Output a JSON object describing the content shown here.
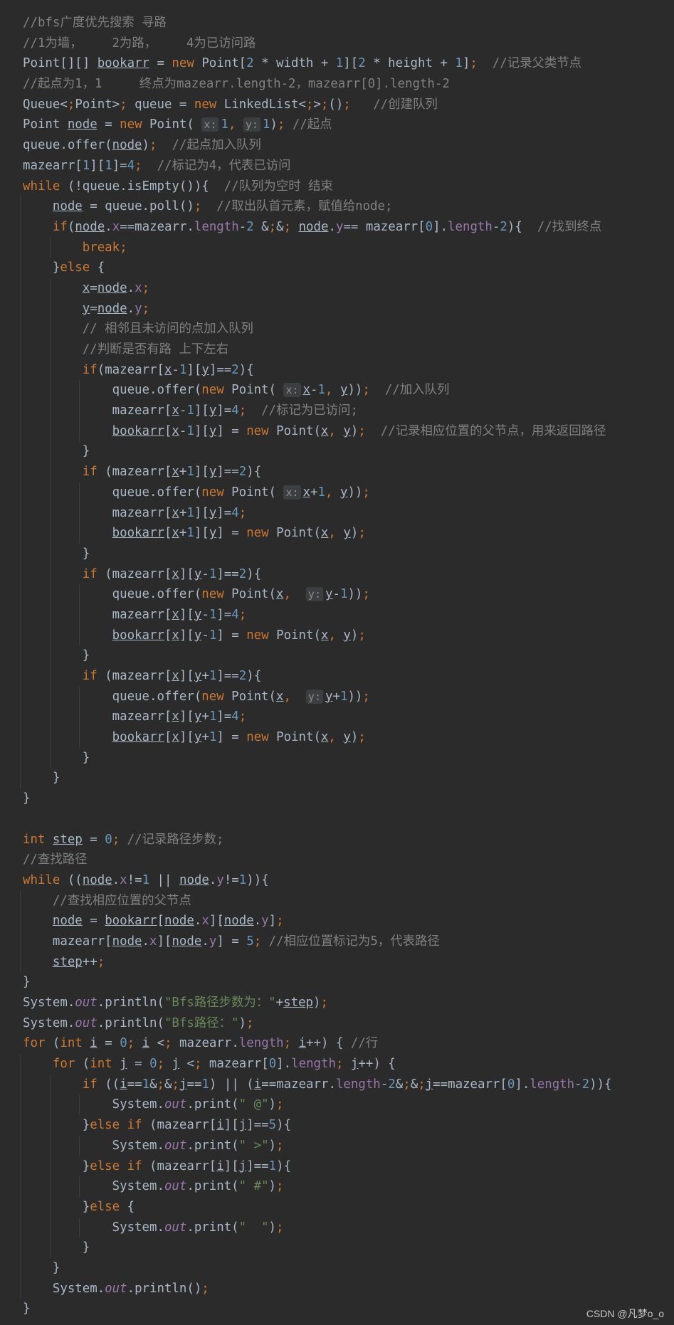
{
  "watermark": "CSDN @凡梦o_o",
  "code_lines": [
    "//bfs广度优先搜索 寻路",
    "//1为墙，    2为路，    4为已访问路",
    "Point[][] bookarr = new Point[2 * width + 1][2 * height + 1];  //记录父类节点",
    "//起点为1，1     终点为mazearr.length-2，mazearr[0].length-2",
    "Queue<Point> queue = new LinkedList<>();   //创建队列",
    "Point node = new Point( x: 1, y: 1); //起点",
    "queue.offer(node);  //起点加入队列",
    "mazearr[1][1]=4;  //标记为4，代表已访问",
    "while (!queue.isEmpty()){  //队列为空时 结束",
    "    node = queue.poll();  //取出队首元素，赋值给node;",
    "    if(node.x==mazearr.length-2 && node.y== mazearr[0].length-2){  //找到终点",
    "        break;",
    "    }else {",
    "        x=node.x;",
    "        y=node.y;",
    "        // 相邻且未访问的点加入队列",
    "        //判断是否有路 上下左右",
    "        if(mazearr[x-1][y]==2){",
    "            queue.offer(new Point( x: x-1, y));  //加入队列",
    "            mazearr[x-1][y]=4;  //标记为已访问;",
    "            bookarr[x-1][y] = new Point(x, y);  //记录相应位置的父节点，用来返回路径",
    "        }",
    "        if (mazearr[x+1][y]==2){",
    "            queue.offer(new Point( x: x+1, y));",
    "            mazearr[x+1][y]=4;",
    "            bookarr[x+1][y] = new Point(x, y);",
    "        }",
    "        if (mazearr[x][y-1]==2){",
    "            queue.offer(new Point(x,  y: y-1));",
    "            mazearr[x][y-1]=4;",
    "            bookarr[x][y-1] = new Point(x, y);",
    "        }",
    "        if (mazearr[x][y+1]==2){",
    "            queue.offer(new Point(x,  y: y+1));",
    "            mazearr[x][y+1]=4;",
    "            bookarr[x][y+1] = new Point(x, y);",
    "        }",
    "    }",
    "}",
    "",
    "int step = 0; //记录路径步数;",
    "//查找路径",
    "while ((node.x!=1 || node.y!=1)){",
    "    //查找相应位置的父节点",
    "    node = bookarr[node.x][node.y];",
    "    mazearr[node.x][node.y] = 5; //相应位置标记为5，代表路径",
    "    step++;",
    "}",
    "System.out.println(\"Bfs路径步数为：\"+step);",
    "System.out.println(\"Bfs路径：\");",
    "for (int i = 0; i < mazearr.length; i++) { //行",
    "    for (int j = 0; j < mazearr[0].length; j++) {",
    "        if ((i==1&&j==1) || (i==mazearr.length-2&&j==mazearr[0].length-2)){",
    "            System.out.print(\" @\");",
    "        }else if (mazearr[i][j]==5){",
    "            System.out.print(\" >\");",
    "        }else if (mazearr[i][j]==1){",
    "            System.out.print(\" #\");",
    "        }else {",
    "            System.out.print(\"  \");",
    "        }",
    "    }",
    "    System.out.println();",
    "}"
  ]
}
